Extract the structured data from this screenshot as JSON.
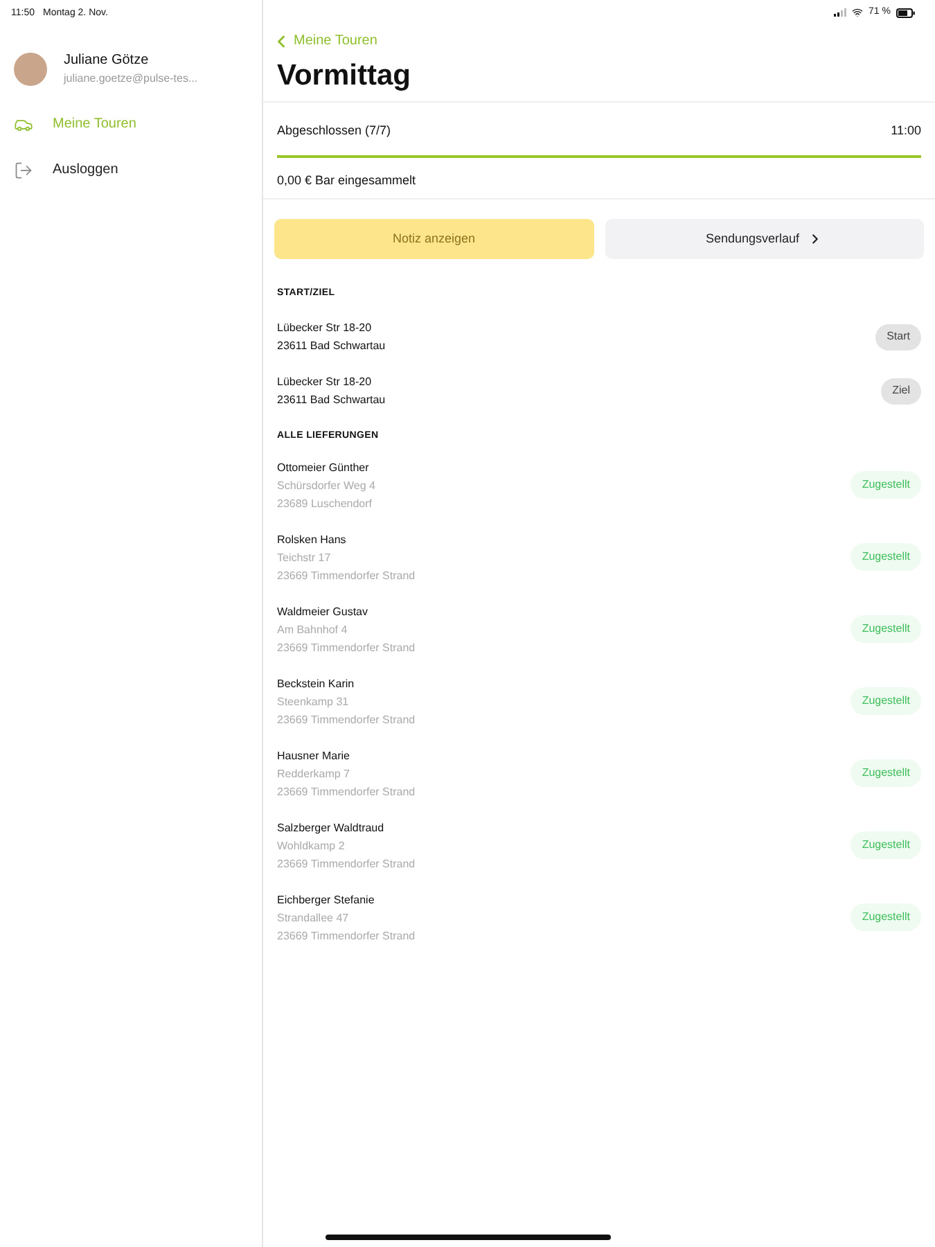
{
  "status_bar": {
    "time": "11:50",
    "date": "Montag 2. Nov.",
    "battery": "71 %"
  },
  "sidebar": {
    "profile": {
      "name": "Juliane Götze",
      "email": "juliane.goetze@pulse-tes..."
    },
    "items": [
      {
        "label": "Meine Touren",
        "kind": "tours",
        "selected": true
      },
      {
        "label": "Ausloggen",
        "kind": "logout",
        "selected": false
      }
    ]
  },
  "main": {
    "back": "Meine Touren",
    "title": "Vormittag",
    "progress": {
      "label": "Abgeschlossen (7/7)",
      "time": "11:00",
      "level": 1
    },
    "cash": "0,00 € Bar eingesammelt",
    "buttons": [
      {
        "label": "Notiz anzeigen",
        "kind": "note",
        "disabled": true
      },
      {
        "label": "Sendungsverlauf",
        "kind": "history",
        "disabled": false
      }
    ],
    "start_section": {
      "heading": "START/ZIEL",
      "rows": [
        {
          "street": "Lübecker Str 18-20",
          "city": "23611 Bad Schwartau",
          "badge": "Start"
        },
        {
          "street": "Lübecker Str 18-20",
          "city": "23611 Bad Schwartau",
          "badge": "Ziel"
        }
      ]
    },
    "deliveries": {
      "heading": "ALLE LIEFERUNGEN",
      "rows": [
        {
          "name": "Ottomeier Günther",
          "street": "Schürsdorfer Weg 4",
          "city": "23689 Luschendorf",
          "status": "Zugestellt"
        },
        {
          "name": "Rolsken Hans",
          "street": "Teichstr 17",
          "city": "23669 Timmendorfer Strand",
          "status": "Zugestellt"
        },
        {
          "name": "Waldmeier Gustav",
          "street": "Am Bahnhof 4",
          "city": "23669 Timmendorfer Strand",
          "status": "Zugestellt"
        },
        {
          "name": "Beckstein Karin",
          "street": "Steenkamp 31",
          "city": "23669 Timmendorfer Strand",
          "status": "Zugestellt"
        },
        {
          "name": "Hausner Marie",
          "street": "Redderkamp 7",
          "city": "23669 Timmendorfer Strand",
          "status": "Zugestellt"
        },
        {
          "name": "Salzberger Waldtraud",
          "street": "Wohldkamp 2",
          "city": "23669 Timmendorfer Strand",
          "status": "Zugestellt"
        },
        {
          "name": "Eichberger Stefanie",
          "street": "Strandallee 47",
          "city": "23669 Timmendorfer Strand",
          "status": "Zugestellt"
        }
      ]
    }
  }
}
